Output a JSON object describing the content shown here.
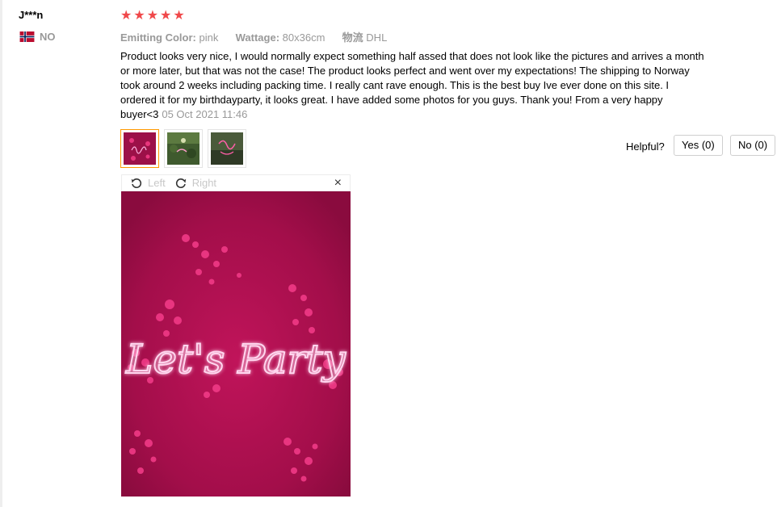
{
  "reviewer": {
    "name": "J***n",
    "country_code": "NO",
    "flag_icon": "norway-flag-icon"
  },
  "rating": {
    "stars": 5,
    "max": 5,
    "star_color": "#f0484a"
  },
  "attributes": [
    {
      "label": "Emitting Color:",
      "value": "pink"
    },
    {
      "label": "Wattage:",
      "value": "80x36cm"
    },
    {
      "label": "物流",
      "value": "DHL"
    }
  ],
  "review": {
    "text": "Product looks very nice, I would normally expect something half assed that does not look like the pictures and arrives a month or more later, but that was not the case! The product looks perfect and went over my expectations! The shipping to Norway took around 2 weeks including packing time. I really cant rave enough. This is the best buy Ive ever done on this site. I ordered it for my birthdayparty, it looks great. I have added some photos for you guys. Thank you! From a very happy buyer<3",
    "date": "05 Oct 2021 11:46"
  },
  "helpful": {
    "label": "Helpful?",
    "yes_label": "Yes (0)",
    "no_label": "No (0)"
  },
  "viewer": {
    "rotate_left_label": "Left",
    "rotate_right_label": "Right",
    "close_glyph": "×",
    "image_text": "Let's Party",
    "neon_color": "#ff3fa8",
    "background_color": "#b8124f"
  },
  "photos": [
    {
      "icon": "neon-sign-photo",
      "active": true
    },
    {
      "icon": "garden-party-photo",
      "active": false
    },
    {
      "icon": "neon-wall-photo",
      "active": false
    }
  ]
}
